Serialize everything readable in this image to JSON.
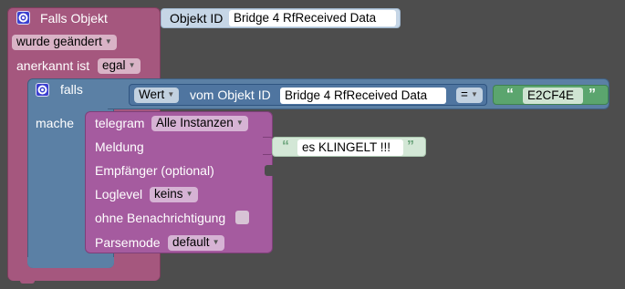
{
  "trigger": {
    "title": "Falls Objekt",
    "object_id_label": "Objekt ID",
    "object_id_value": "Bridge 4 RfReceived  Data",
    "change_option": "wurde geändert",
    "ack_label": "anerkannt ist",
    "ack_option": "egal"
  },
  "if_block": {
    "falls_label": "falls",
    "mache_label": "mache",
    "value_option": "Wert",
    "from_object_label": "vom Objekt ID",
    "object_id_value": "Bridge 4 RfReceived  Data",
    "operator": "=",
    "compare_text": "E2CF4E"
  },
  "telegram": {
    "label": "telegram",
    "instance_option": "Alle Instanzen",
    "message_label": "Meldung",
    "message_text": "es KLINGELT !!!",
    "recipient_label": "Empfänger (optional)",
    "loglevel_label": "Loglevel",
    "loglevel_option": "keins",
    "silent_label": "ohne Benachrichtigung",
    "parsemode_label": "Parsemode",
    "parsemode_option": "default"
  },
  "colors": {
    "background": "#4d4d4d",
    "trigger_block": "#a5577e",
    "if_block": "#5b80a5",
    "telegram_block": "#a55b9f",
    "text_block": "#cfe4d2",
    "object_id_block": "#c6d6e6"
  },
  "icons": [
    "gear-icon",
    "quote-open-icon",
    "quote-close-icon",
    "dropdown-caret-icon"
  ]
}
